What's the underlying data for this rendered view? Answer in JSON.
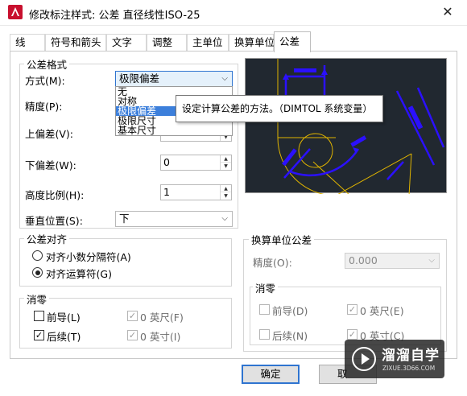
{
  "window": {
    "title": "修改标注样式: 公差 直径线性ISO-25",
    "close_glyph": "✕"
  },
  "tabs": [
    {
      "label": "线"
    },
    {
      "label": "符号和箭头"
    },
    {
      "label": "文字"
    },
    {
      "label": "调整"
    },
    {
      "label": "主单位"
    },
    {
      "label": "换算单位"
    },
    {
      "label": "公差"
    }
  ],
  "tolerance_format": {
    "title": "公差格式",
    "method_label": "方式(M):",
    "method_value": "极限偏差",
    "method_options": [
      "无",
      "对称",
      "极限偏差",
      "极限尺寸",
      "基本尺寸"
    ],
    "precision_label": "精度(P):",
    "upper_label": "上偏差(V):",
    "lower_label": "下偏差(W):",
    "lower_value": "0",
    "height_label": "高度比例(H):",
    "height_value": "1",
    "vertical_label": "垂直位置(S):",
    "vertical_value": "下"
  },
  "tooltip": {
    "text": "设定计算公差的方法。（DIMTOL 系统变量）"
  },
  "alignment": {
    "title": "公差对齐",
    "option_decimal": "对齐小数分隔符(A)",
    "option_operator": "对齐运算符(G)",
    "selected": "operator"
  },
  "zero_suppress": {
    "title": "消零",
    "leading_label": "前导(L)",
    "leading_checked": false,
    "trailing_label": "后续(T)",
    "trailing_checked": true,
    "feet_label": "0 英尺(F)",
    "feet_checked": true,
    "inches_label": "0 英寸(I)",
    "inches_checked": true
  },
  "alt_tolerance": {
    "title": "换算单位公差",
    "precision_label": "精度(O):",
    "precision_value": "0.000",
    "zero_title": "消零",
    "leading_label": "前导(D)",
    "leading_checked": false,
    "trailing_label": "后续(N)",
    "trailing_checked": false,
    "feet_label": "0 英尺(E)",
    "feet_checked": true,
    "inches_label": "0 英寸(C)",
    "inches_checked": true
  },
  "buttons": {
    "ok": "确定",
    "cancel": "取"
  },
  "watermark": {
    "title": "溜溜自学",
    "subtitle": "ZIXUE.3D66.COM"
  },
  "colors": {
    "accent": "#2f74d0",
    "selection": "#3c7fdb",
    "preview_bg": "#212830",
    "preview_dim": "#2b10ff",
    "preview_geom": "#e0b400",
    "autocad_red": "#c8102e"
  }
}
